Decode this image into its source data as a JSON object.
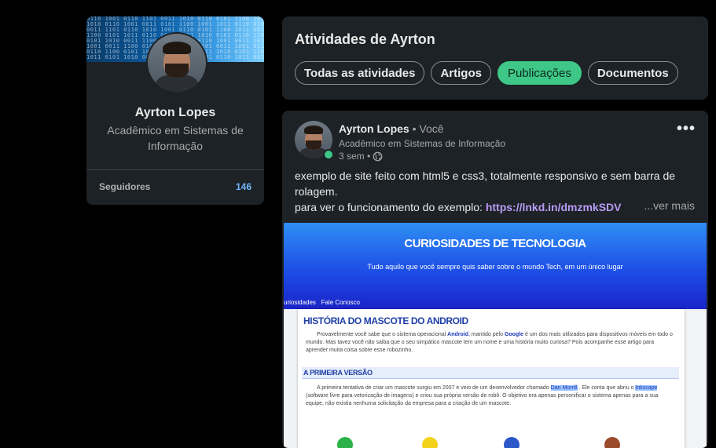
{
  "profile": {
    "name": "Ayrton Lopes",
    "headline": "Acadêmico em Sistemas de Informação",
    "followers_label": "Seguidores",
    "followers_count": "146"
  },
  "activities": {
    "title": "Atividades de Ayrton",
    "tabs": [
      {
        "label": "Todas as atividades",
        "active": false
      },
      {
        "label": "Artigos",
        "active": false
      },
      {
        "label": "Publicações",
        "active": true
      },
      {
        "label": "Documentos",
        "active": false
      }
    ],
    "accent_color": "#3ec787"
  },
  "post": {
    "author_name": "Ayrton Lopes",
    "author_suffix": " • Você",
    "author_headline": "Acadêmico em Sistemas de Informação",
    "time": "3 sem •",
    "visibility_icon": "globe-icon",
    "more_icon": "more-options-icon",
    "text_line1": "exemplo de site feito com html5 e css3, totalmente responsivo e sem barra de rolagem.",
    "text_line2_prefix": "para ver o funcionamento do exemplo: ",
    "link": "https://lnkd.in/dmzmkSDV",
    "see_more": "...ver mais",
    "link_color": "#b99bf5"
  },
  "embed": {
    "hero_title": "CURIOSIDADES DE TECNOLOGIA",
    "hero_subtitle": "Tudo aquilo que você sempre quis saber sobre o mundo Tech, em um único lugar",
    "nav": [
      "uriosidades",
      "Fale Conosco"
    ],
    "article_title": "HISTÓRIA DO MASCOTE DO ANDROID",
    "p1_a": "Provavelmente você sabe que o sistema operacional ",
    "p1_android": "Android",
    "p1_b": ", mantido pelo ",
    "p1_google": "Google",
    "p1_c": " é um dos mais utilizados para dispositivos móveis em todo o mundo. Mas tavez você não saiba que o seu simpático mascote tem um nome e uma história muito curiosa? Pois acompanhe esse artigo para aprender muita coisa sobre esse robozinho.",
    "section_title": "A PRIMEIRA VERSÃO",
    "p2_a": "A primeira tentativa de criar um mascote surgiu em 2007 e veio de um desenvolvedor chamado ",
    "p2_dan": "Dan Morrill",
    "p2_b": " . Ele conta que abriu o ",
    "p2_inkscape": "Inkscape",
    "p2_c": " (software livre para vetorização de imagens) e criou sua própria versão de robô. O objetivo era apenas personificar o sistema apenas para a sua equipe, não existia nenhuma solicitação da empresa para a criação de um mascote."
  }
}
